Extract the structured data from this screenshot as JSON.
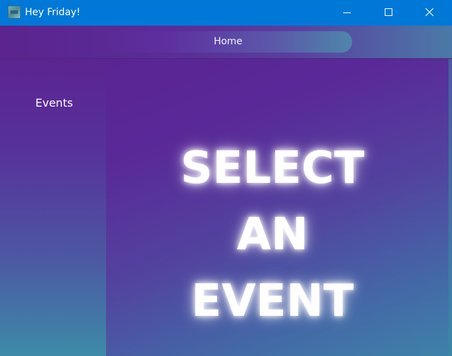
{
  "window": {
    "title": "Hey Friday!"
  },
  "icons": {
    "app": "app-icon",
    "minimize": "minimize-icon",
    "maximize": "maximize-icon",
    "close": "close-icon"
  },
  "nav": {
    "home_label": "Home"
  },
  "sidebar": {
    "events_label": "Events"
  },
  "main": {
    "headline_lines": [
      "SELECT",
      "AN",
      "EVENT"
    ]
  },
  "colors": {
    "titlebar": "#0078d7",
    "purple": "#5a2494",
    "teal": "#3f84a8",
    "text": "#ffffff"
  }
}
